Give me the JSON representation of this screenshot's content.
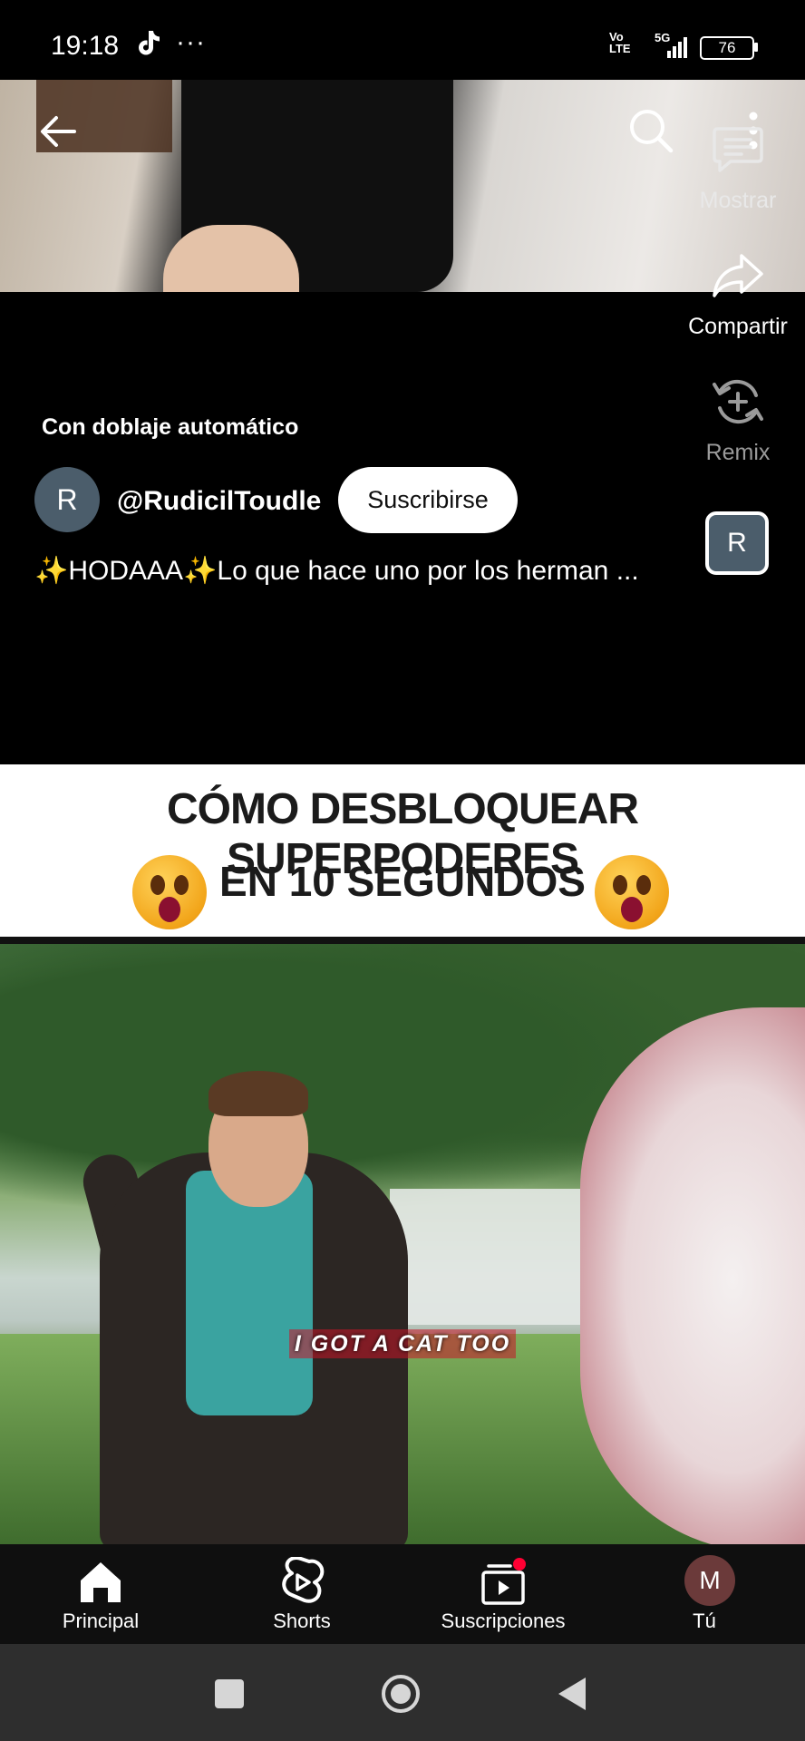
{
  "status_bar": {
    "time": "19:18",
    "network_top": "Vo",
    "network_bottom": "LTE",
    "signal": "5G",
    "battery": "76"
  },
  "right_rail": {
    "comments_label": "Mostrar",
    "share_label": "Compartir",
    "remix_label": "Remix",
    "channel_thumb_letter": "R"
  },
  "short_info": {
    "dubbed_label": "Con doblaje automático",
    "avatar_letter": "R",
    "channel_name": "@RudicilToudle",
    "subscribe_label": "Suscribirse",
    "caption": "✨HODAAA✨Lo que hace uno por los herman ..."
  },
  "video_banner": {
    "line1": "CÓMO DESBLOQUEAR SUPERPODERES",
    "line2": "EN 10 SEGUNDOS",
    "subtitle": "I GOT A CAT TOO"
  },
  "bottom_nav": {
    "items": [
      {
        "label": "Principal",
        "icon": "home-icon"
      },
      {
        "label": "Shorts",
        "icon": "shorts-icon"
      },
      {
        "label": "Suscripciones",
        "icon": "subscriptions-icon"
      },
      {
        "label": "Tú",
        "icon": "avatar",
        "avatar_letter": "M"
      }
    ]
  },
  "colors": {
    "accent_red": "#ff0033",
    "background": "#000000",
    "nav_background": "#0f0f0f"
  }
}
